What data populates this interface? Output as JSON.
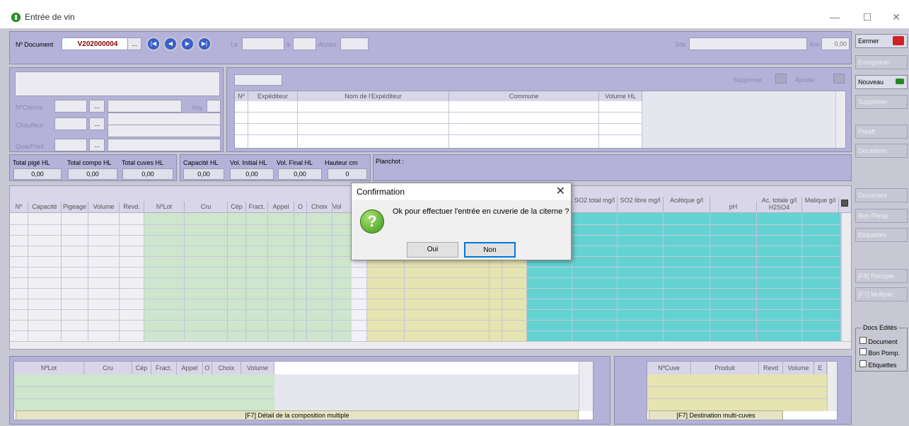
{
  "window": {
    "title": "Entrée de vin",
    "minimize": "—",
    "maximize": "☐",
    "close": "✕"
  },
  "header": {
    "doc_label": "Nº Document",
    "doc_value": "V202000004",
    "browse": "...",
    "le_label": "Le",
    "a_label": "à",
    "annee_label": "Année",
    "site_label": "Site",
    "km_label": "Km",
    "km_value": "0,00"
  },
  "citerne": {
    "citerne_label": "NºCiterne",
    "voy_label": "Voy.",
    "chauffeur_label": "Chauffeur",
    "quai_label": "Quai/Pont"
  },
  "expediteurs": {
    "supprimer": "Supprimer",
    "ajouter": "Ajouter",
    "columns": [
      "Nº",
      "Expéditeur",
      "Nom de l'Expéditeur",
      "Commune",
      "Volume HL"
    ]
  },
  "totals": {
    "pige_label": "Total pigé HL",
    "pige_value": "0,00",
    "compo_label": "Total compo HL",
    "compo_value": "0,00",
    "cuves_label": "Total cuves HL",
    "cuves_value": "0,00",
    "capacite_label": "Capacité HL",
    "capacite_value": "0,00",
    "volinit_label": "Vol. Initial HL",
    "volinit_value": "0,00",
    "volfinal_label": "Vol. Final HL",
    "volfinal_value": "0,00",
    "hauteur_label": "Hauteur cm",
    "hauteur_value": "0",
    "planchot_label": "Planchot :"
  },
  "main_grid": {
    "columns": [
      "Nº",
      "Capacité",
      "Pigeage",
      "Volume",
      "Revd.",
      "NºLot",
      "Cru",
      "Cép",
      "Fract.",
      "Appel",
      "O",
      "Choix",
      "Vol",
      "SO2 total mg/l",
      "SO2 libre mg/l",
      "Acétique g/l",
      "pH",
      "Ac. totale g/l H2SO4",
      "Malique g/l"
    ]
  },
  "side_buttons": [
    {
      "label": "Eermer",
      "active": true
    },
    {
      "label": "Enregistrer",
      "active": false
    },
    {
      "label": "Nouveau",
      "active": true
    },
    {
      "label": "Supprimer",
      "active": false
    },
    {
      "label": "Préaff.",
      "active": false
    },
    {
      "label": "Docadmin",
      "active": false
    },
    {
      "label": "Document",
      "active": false
    },
    {
      "label": "Bon Pomp.",
      "active": false
    },
    {
      "label": "Etiquettes",
      "active": false
    },
    {
      "label": "[F8] Recopie",
      "active": false
    },
    {
      "label": "[F7] Multiple",
      "active": false
    }
  ],
  "docs_edites": {
    "title": "Docs Edités",
    "items": [
      "Document",
      "Bon Pomp.",
      "Etiquettes"
    ]
  },
  "compo": {
    "columns": [
      "NºLot",
      "Cru",
      "Cép",
      "Fract.",
      "Appel",
      "O",
      "Choix",
      "Volume"
    ],
    "footer": "[F7] Détail de la composition multiple"
  },
  "multicuves": {
    "columns": [
      "NºCuve",
      "Produit",
      "Revd",
      "Volume",
      "E"
    ],
    "footer": "[F7] Destination multi-cuves"
  },
  "dialog": {
    "title": "Confirmation",
    "message": "Ok pour effectuer l'entrée en cuverie de la citerne ?",
    "yes": "Oui",
    "no": "Non",
    "close": "✕",
    "icon": "?"
  }
}
